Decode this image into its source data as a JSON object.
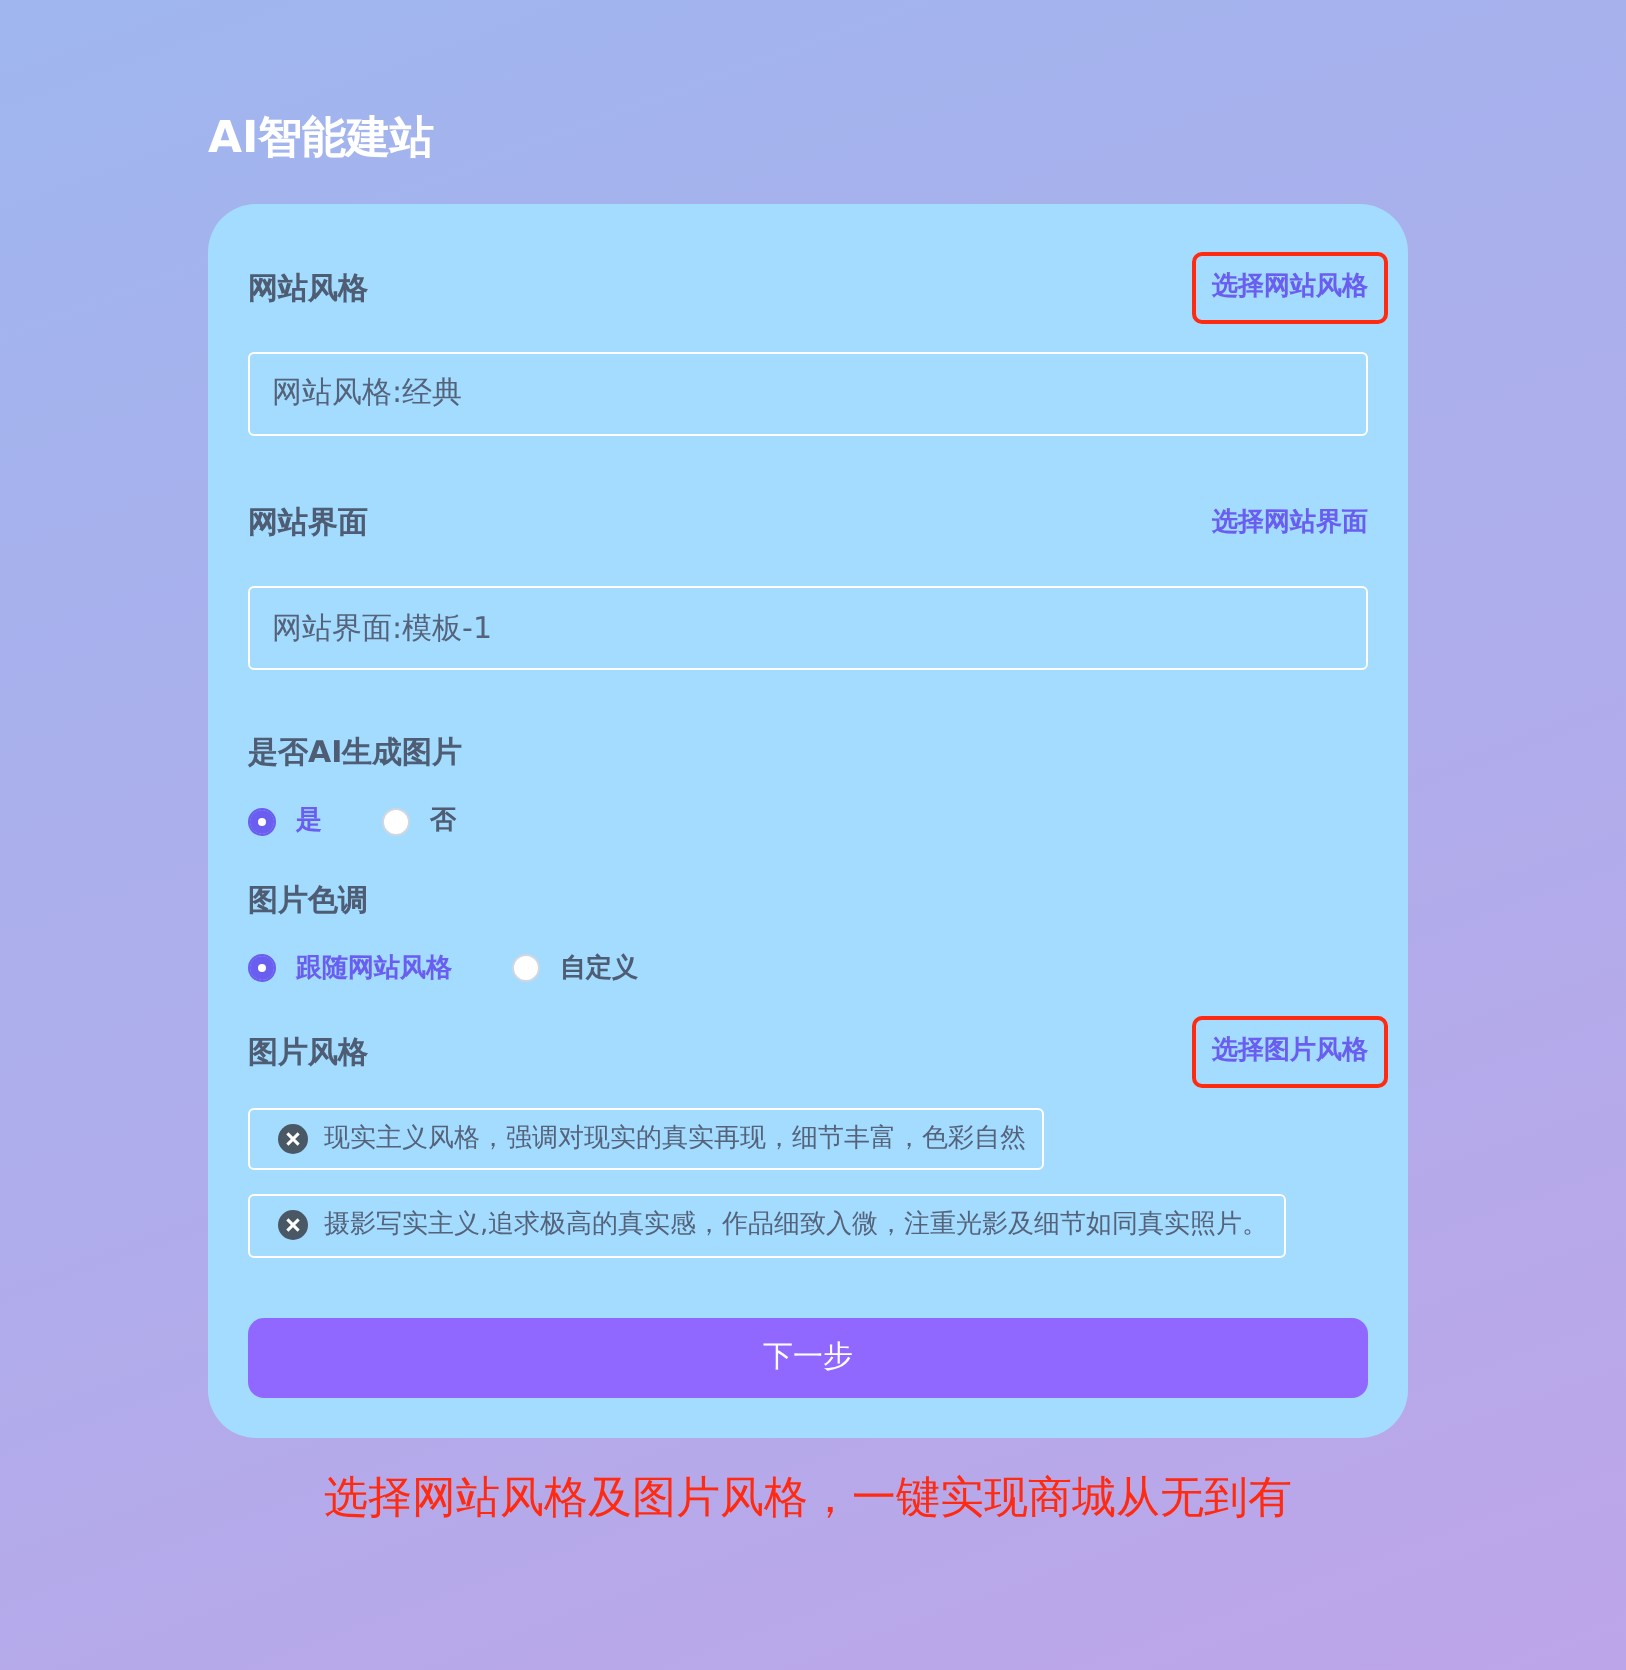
{
  "title": "AI智能建站",
  "sections": [
    {
      "kind": "field",
      "label": "网站风格",
      "action": {
        "text": "选择网站风格",
        "highlighted": true
      },
      "value": "网站风格:经典"
    },
    {
      "kind": "field",
      "label": "网站界面",
      "action": {
        "text": "选择网站界面",
        "highlighted": false
      },
      "value": "网站界面:模板-1"
    },
    {
      "kind": "radio",
      "label": "是否AI生成图片",
      "options": [
        {
          "text": "是",
          "selected": true
        },
        {
          "text": "否",
          "selected": false
        }
      ]
    },
    {
      "kind": "radio",
      "label": "图片色调",
      "options": [
        {
          "text": "跟随网站风格",
          "selected": true
        },
        {
          "text": "自定义",
          "selected": false
        }
      ]
    },
    {
      "kind": "tags",
      "label": "图片风格",
      "action": {
        "text": "选择图片风格",
        "highlighted": true
      },
      "tags": [
        "现实主义风格，强调对现实的真实再现，细节丰富，色彩自然",
        "摄影写实主义,追求极高的真实感，作品细致入微，注重光影及细节如同真实照片。"
      ]
    }
  ],
  "next_button": "下一步",
  "caption": "选择网站风格及图片风格，一键实现商城从无到有"
}
